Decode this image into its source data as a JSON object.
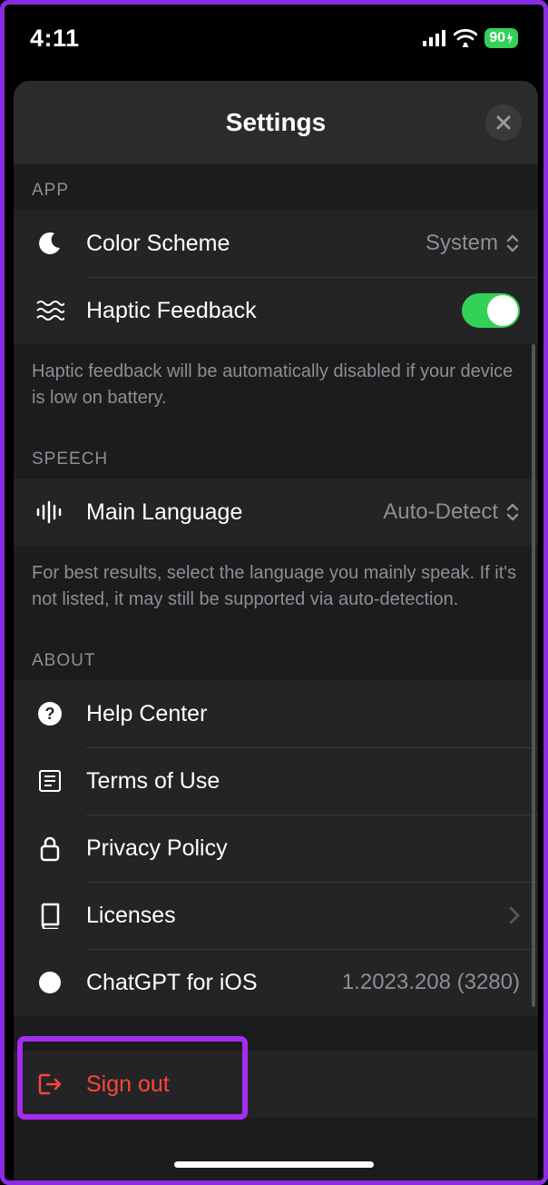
{
  "status": {
    "time": "4:11",
    "battery": "90"
  },
  "header": {
    "title": "Settings"
  },
  "sections": {
    "app": {
      "label": "APP",
      "color_scheme": {
        "label": "Color Scheme",
        "value": "System"
      },
      "haptic": {
        "label": "Haptic Feedback",
        "on": true
      },
      "footer": "Haptic feedback will be automatically disabled if your device is low on battery."
    },
    "speech": {
      "label": "SPEECH",
      "main_language": {
        "label": "Main Language",
        "value": "Auto-Detect"
      },
      "footer": "For best results, select the language you mainly speak. If it's not listed, it may still be supported via auto-detection."
    },
    "about": {
      "label": "ABOUT",
      "help": "Help Center",
      "terms": "Terms of Use",
      "privacy": "Privacy Policy",
      "licenses": "Licenses",
      "app_name": "ChatGPT for iOS",
      "version": "1.2023.208 (3280)"
    },
    "signout": {
      "label": "Sign out"
    }
  },
  "colors": {
    "accent": "#33d158",
    "destructive": "#ff453a",
    "highlight": "#a52cf0"
  }
}
